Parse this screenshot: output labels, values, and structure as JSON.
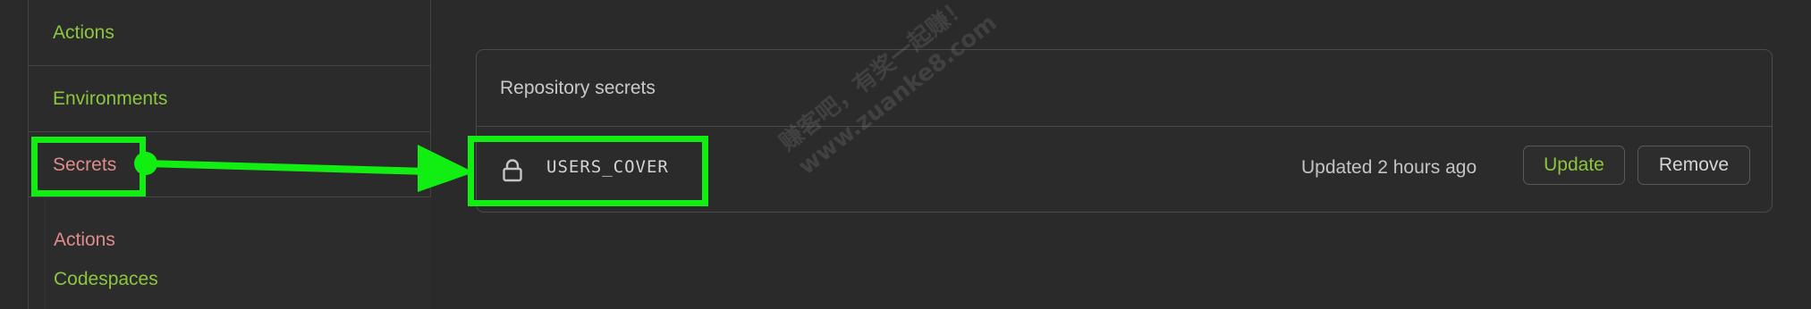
{
  "sidebar": {
    "items": [
      {
        "label": "Actions"
      },
      {
        "label": "Environments"
      },
      {
        "label": "Secrets"
      }
    ],
    "sub_items": [
      {
        "label": "Actions"
      },
      {
        "label": "Codespaces"
      }
    ]
  },
  "panel": {
    "header": "Repository secrets",
    "secrets": [
      {
        "icon": "lock-icon",
        "name": "USERS_COVER",
        "updated": "Updated 2 hours ago",
        "update_label": "Update",
        "remove_label": "Remove"
      }
    ]
  },
  "watermark": {
    "line1": "赚客吧，有奖一起赚！",
    "line2": "www.zuanke8.com"
  },
  "colors": {
    "background": "#2a2a2a",
    "link_green": "#8cc63f",
    "link_pink": "#e08b8b",
    "annotation_green": "#11ee11",
    "border": "#4a4a4a"
  }
}
